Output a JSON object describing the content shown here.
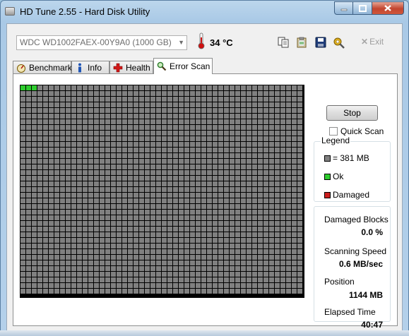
{
  "window": {
    "title": "HD Tune 2.55 - Hard Disk Utility"
  },
  "toolbar": {
    "drive": "WDC WD1002FAEX-00Y9A0 (1000 GB)",
    "temperature": "34 °C",
    "exit_label": "Exit"
  },
  "tabs": [
    {
      "label": "Benchmark",
      "icon": "benchmark-icon"
    },
    {
      "label": "Info",
      "icon": "info-icon"
    },
    {
      "label": "Health",
      "icon": "health-cross-icon"
    },
    {
      "label": "Error Scan",
      "icon": "magnifier-icon"
    }
  ],
  "active_tab": "Error Scan",
  "scan": {
    "stop_label": "Stop",
    "quick_scan_label": "Quick Scan",
    "quick_scan_checked": false,
    "grid_columns": 50,
    "grid_rows": 37,
    "ok_blocks": 3
  },
  "legend": {
    "caption": "Legend",
    "block_size": "= 381 MB",
    "ok": "Ok",
    "damaged": "Damaged",
    "colors": {
      "block": "#808080",
      "ok": "#2ecc2e",
      "damaged": "#cc1e1e"
    }
  },
  "stats": {
    "damaged_blocks_label": "Damaged Blocks",
    "damaged_blocks_value": "0.0 %",
    "speed_label": "Scanning Speed",
    "speed_value": "0.6 MB/sec",
    "position_label": "Position",
    "position_value": "1144 MB",
    "elapsed_label": "Elapsed Time",
    "elapsed_value": "40:47"
  }
}
